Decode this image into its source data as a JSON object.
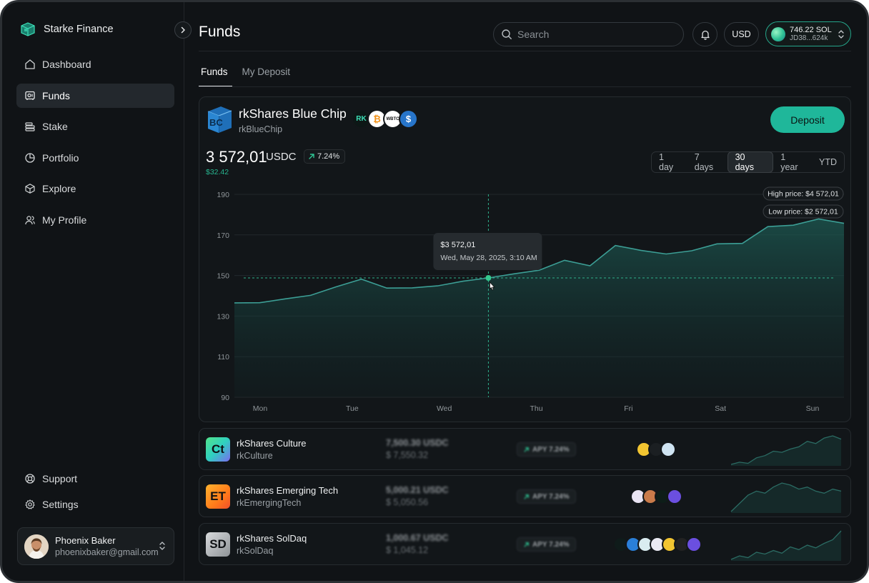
{
  "app": {
    "name": "Starke Finance"
  },
  "nav": {
    "items": [
      {
        "label": "Dashboard",
        "icon": "home-icon"
      },
      {
        "label": "Funds",
        "icon": "safe-icon",
        "active": true
      },
      {
        "label": "Stake",
        "icon": "stack-icon"
      },
      {
        "label": "Portfolio",
        "icon": "pie-chart-icon"
      },
      {
        "label": "Explore",
        "icon": "cube-icon"
      },
      {
        "label": "My Profile",
        "icon": "users-icon"
      }
    ],
    "bottom": [
      {
        "label": "Support",
        "icon": "lifebuoy-icon"
      },
      {
        "label": "Settings",
        "icon": "gear-icon"
      }
    ]
  },
  "user": {
    "name": "Phoenix Baker",
    "email": "phoenixbaker@gmail.com"
  },
  "header": {
    "title": "Funds",
    "search_placeholder": "Search",
    "currency": "USD",
    "wallet": {
      "amount": "746.22 SOL",
      "address": "JD38...624k"
    }
  },
  "tabs": [
    {
      "label": "Funds",
      "active": true
    },
    {
      "label": "My Deposit",
      "active": false
    }
  ],
  "fund": {
    "name": "rkShares Blue Chip",
    "ticker": "rkBlueChip",
    "deposit_label": "Deposit",
    "price": "3 572,01",
    "unit": "USDC",
    "change": "7.24%",
    "delta": "$32.42",
    "coins": [
      "RK",
      "₿",
      "WBTC",
      "$"
    ]
  },
  "ranges": [
    {
      "label": "1 day",
      "active": false
    },
    {
      "label": "7 days",
      "active": false
    },
    {
      "label": "30 days",
      "active": true
    },
    {
      "label": "1 year",
      "active": false
    },
    {
      "label": "YTD",
      "active": false
    }
  ],
  "chart_data": {
    "type": "area",
    "x": [
      "Mon",
      "Tue",
      "Wed",
      "Thu",
      "Fri",
      "Sat",
      "Sun"
    ],
    "yticks": [
      190,
      170,
      150,
      130,
      110,
      90
    ],
    "ylim": [
      90,
      190
    ],
    "series": [
      {
        "values": [
          136.5,
          136.6,
          138.5,
          140.2,
          144.4,
          148.2,
          143.8,
          143.9,
          144.9,
          147.2,
          148.8,
          150.8,
          152.6,
          157.5,
          154.8,
          164.8,
          162.4,
          160.6,
          162.2,
          165.6,
          165.8,
          174.1,
          174.8,
          177.9,
          175.7
        ]
      }
    ],
    "grid": true,
    "reference_value": 148.8,
    "tooltip": {
      "value": "$3 572,01",
      "date": "Wed, May 28, 2025, 3:10 AM"
    },
    "high_label": "High price: $4 572,01",
    "low_label": "Low price: $2 572,01"
  },
  "funds_list": [
    {
      "name": "rkShares Culture",
      "ticker": "rkCulture",
      "logo": "Ct",
      "value": "7,500.30 USDC",
      "sub": "$ 7,550.32",
      "apy": "APY 7.24%",
      "coins": [
        "#f2c531",
        "#1b1f22",
        "#cfe4f2"
      ],
      "spark": [
        12,
        14,
        13,
        18,
        20,
        24,
        23,
        26,
        28,
        33,
        31,
        36,
        38,
        35
      ]
    },
    {
      "name": "rkShares Emerging Tech",
      "ticker": "rkEmergingTech",
      "logo": "ET",
      "value": "5,000.21 USDC",
      "sub": "$ 5,050.56",
      "apy": "APY 7.24%",
      "coins": [
        "#e9e4f3",
        "#c97b4a",
        "#0d1d18",
        "#6b4fe0"
      ],
      "spark": [
        18,
        22,
        26,
        28,
        27,
        30,
        32,
        31,
        29,
        30,
        28,
        27,
        29,
        28
      ]
    },
    {
      "name": "rkShares SolDaq",
      "ticker": "rkSolDaq",
      "logo": "SD",
      "value": "1,000.67 USDC",
      "sub": "$ 1,045.12",
      "apy": "APY 7.24%",
      "coins": [
        "#0f1b1a",
        "#2a7fd8",
        "#d9ecf0",
        "#eaeaf3",
        "#f2c531",
        "#222",
        "#6b4fe0"
      ],
      "spark": [
        8,
        12,
        10,
        16,
        14,
        18,
        15,
        22,
        19,
        24,
        21,
        26,
        30,
        40
      ]
    }
  ]
}
